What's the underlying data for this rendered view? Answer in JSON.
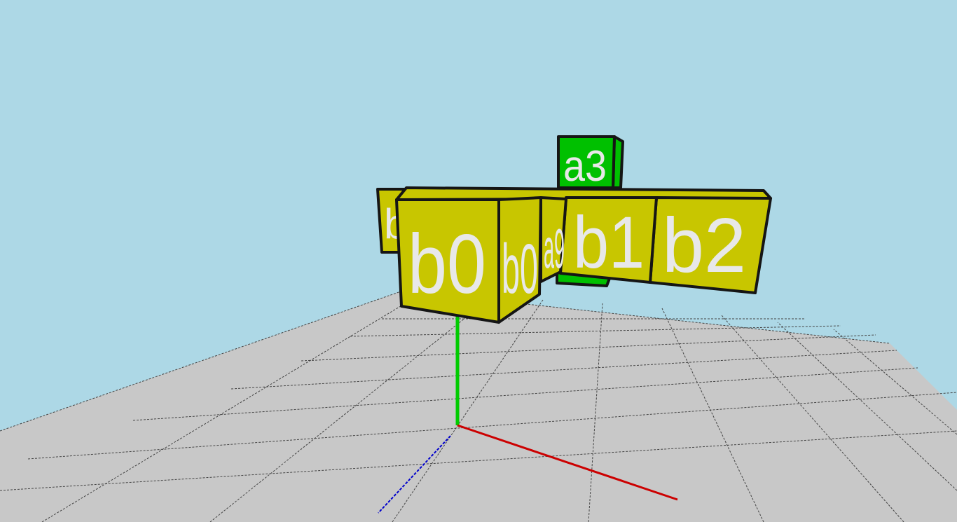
{
  "scene": {
    "sky_color": "#add8e6",
    "floor_color": "#c8c8c8",
    "block_color_b": "#c8c600",
    "block_color_a": "#00c000",
    "axis_colors": {
      "x": "#cc0000",
      "y": "#0000cc",
      "z": "#00cc00"
    },
    "blocks": [
      {
        "label": "b0"
      },
      {
        "label": "b0"
      },
      {
        "label": "a9"
      },
      {
        "label": "b1"
      },
      {
        "label": "b2"
      },
      {
        "label": "a3"
      },
      {
        "label": "b"
      }
    ]
  }
}
